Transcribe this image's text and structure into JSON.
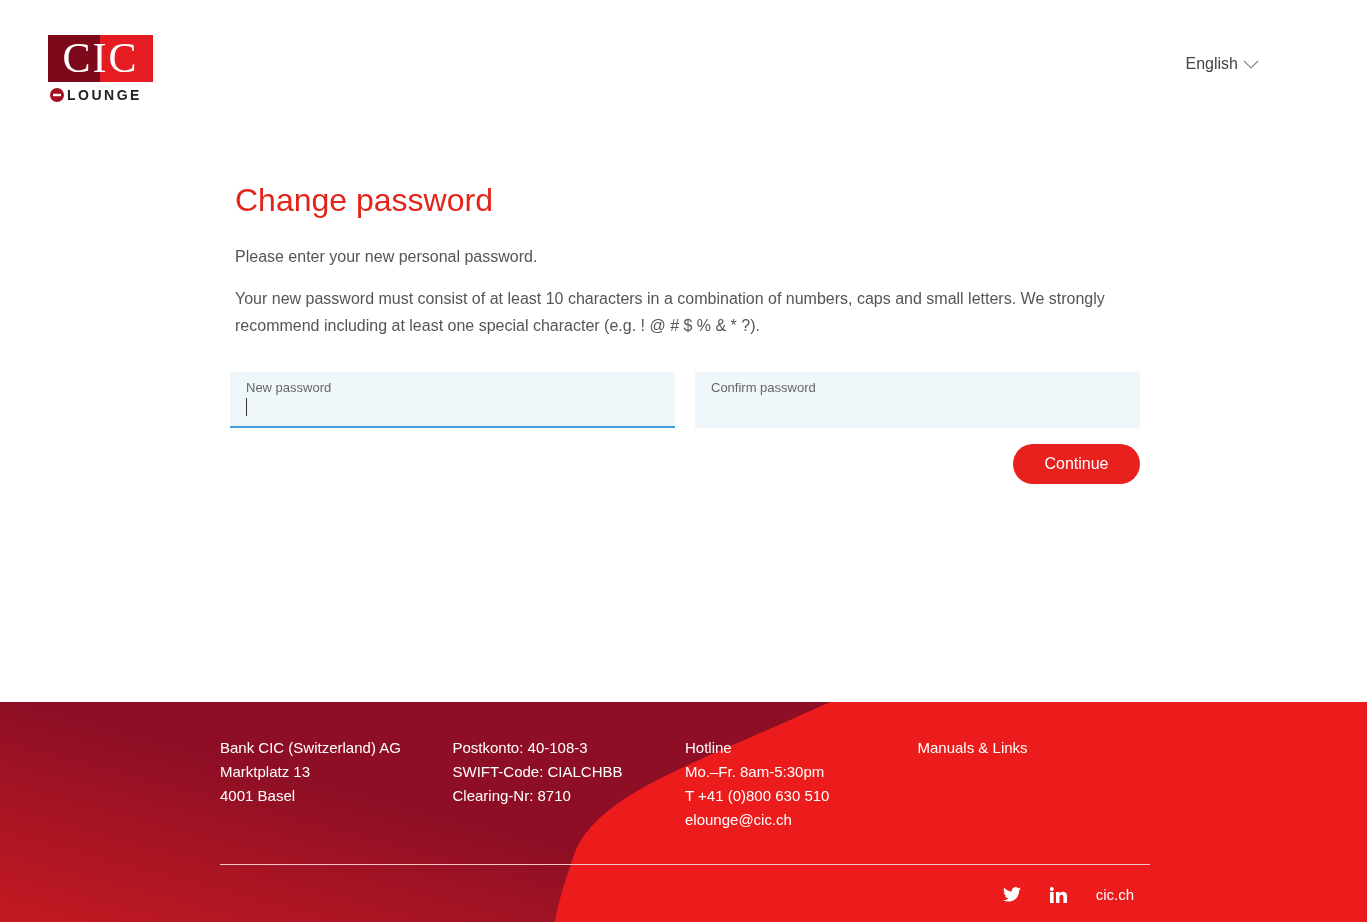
{
  "header": {
    "logo": {
      "mark": "CIC",
      "sub": "LOUNGE"
    },
    "language": {
      "label": "English"
    }
  },
  "main": {
    "title": "Change password",
    "intro": "Please enter your new personal password.",
    "rules": "Your new password must consist of at least 10 characters in a combination of numbers, caps and small letters. We strongly recommend including at least one special character (e.g. ! @ # $ % & * ?).",
    "fields": [
      {
        "label": "New password",
        "focused": true
      },
      {
        "label": "Confirm password",
        "focused": false
      }
    ],
    "button": "Continue"
  },
  "footer": {
    "columns": [
      [
        "Bank CIC (Switzerland) AG",
        "Marktplatz 13",
        "4001 Basel"
      ],
      [
        "Postkonto: 40-108-3",
        "SWIFT-Code: CIALCHBB",
        "Clearing-Nr: 8710"
      ],
      [
        "Hotline",
        "Mo.–Fr. 8am-5:30pm",
        "T +41 (0)800 630 510",
        "elounge@cic.ch"
      ],
      [
        "Manuals & Links"
      ]
    ],
    "social": [
      {
        "kind": "twitter"
      },
      {
        "kind": "linkedin"
      }
    ],
    "site_link": "cic.ch"
  }
}
